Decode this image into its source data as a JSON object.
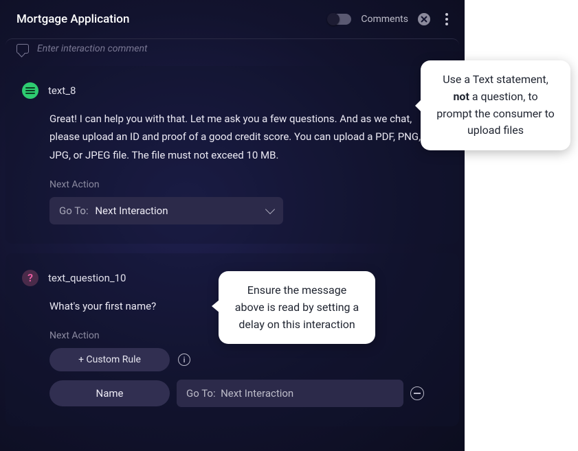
{
  "header": {
    "title": "Mortgage Application",
    "comments_label": "Comments"
  },
  "comment_placeholder": "Enter interaction comment",
  "card1": {
    "step_id": "text_8",
    "message": "Great! I can help you with that. Let me ask you a few questions. And as we chat, please upload an ID and proof of a good credit score. You can upload a PDF, PNG, JPG, or JPEG file. The file must not exceed 10 MB.",
    "next_label": "Next Action",
    "goto_prefix": "Go To:",
    "goto_value": "Next Interaction"
  },
  "card2": {
    "step_id": "text_question_10",
    "message": "What's your first name?",
    "next_label": "Next Action",
    "custom_rule_btn": "+ Custom Rule",
    "slot_name": "Name",
    "goto_prefix": "Go To:",
    "goto_value": "Next Interaction"
  },
  "callouts": {
    "c1_pre": "Use a Text statement, ",
    "c1_bold": "not",
    "c1_post": " a question, to prompt the consumer to upload files",
    "c2": "Ensure the message above is read by setting a delay on this interaction"
  }
}
